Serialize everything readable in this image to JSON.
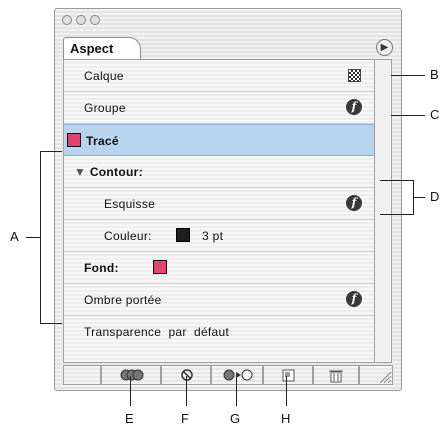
{
  "panel": {
    "tab_label": "Aspect",
    "items": [
      {
        "label": "Calque"
      },
      {
        "label": "Groupe"
      },
      {
        "label": "Tracé"
      },
      {
        "label": "Contour:"
      },
      {
        "label": "Esquisse"
      },
      {
        "label": "Couleur:",
        "value": "3 pt"
      },
      {
        "label": "Fond:"
      },
      {
        "label": "Ombre portée"
      },
      {
        "label": "Transparence  par  défaut"
      }
    ],
    "colors": {
      "stroke_swatch": "#1e1e1e",
      "fill_swatch": "#e0446b",
      "selection": "#b8d3ee"
    }
  },
  "callouts": {
    "a": "A",
    "b": "B",
    "c": "C",
    "d": "D",
    "e": "E",
    "f": "F",
    "g": "G",
    "h": "H"
  }
}
